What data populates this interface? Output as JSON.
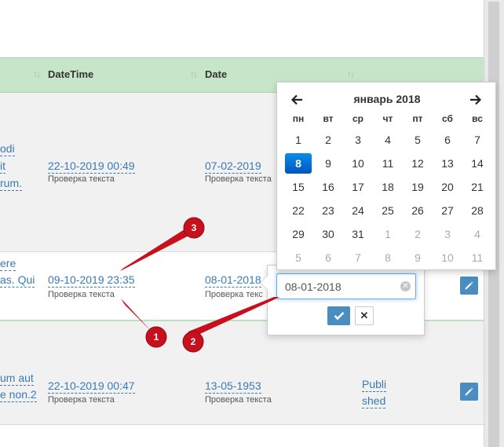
{
  "columns": {
    "datetime": "DateTime",
    "date": "Date"
  },
  "rows": [
    {
      "left_fragments": [
        "odi",
        "it",
        "rum."
      ],
      "datetime": "22-10-2019 00:49",
      "datetime_sub": "Проверка текста",
      "date": "07-02-2019",
      "date_sub": "Проверка текста"
    },
    {
      "left_fragments": [
        "ere",
        "as. Qui"
      ],
      "datetime": "09-10-2019 23:35",
      "datetime_sub": "Проверка текста",
      "date": "08-01-2018",
      "date_sub": "Проверка текс"
    },
    {
      "left_fragments": [
        "um aut",
        "e non.2"
      ],
      "datetime": "22-10-2019 00:47",
      "datetime_sub": "Проверка текста",
      "date": "13-05-1953",
      "date_sub": "Проверка текста",
      "status_lines": [
        "Publi",
        "shed"
      ]
    }
  ],
  "calendar": {
    "title": "январь 2018",
    "weekdays": [
      "пн",
      "вт",
      "ср",
      "чт",
      "пт",
      "сб",
      "вс"
    ],
    "weeks": [
      [
        "1",
        "2",
        "3",
        "4",
        "5",
        "6",
        "7"
      ],
      [
        "8",
        "9",
        "10",
        "11",
        "12",
        "13",
        "14"
      ],
      [
        "15",
        "16",
        "17",
        "18",
        "19",
        "20",
        "21"
      ],
      [
        "22",
        "23",
        "24",
        "25",
        "26",
        "27",
        "28"
      ],
      [
        "29",
        "30",
        "31",
        "1",
        "2",
        "3",
        "4"
      ],
      [
        "5",
        "6",
        "7",
        "8",
        "9",
        "10",
        "11"
      ]
    ],
    "selected_day": "8",
    "prev_icon": "arrow-left-icon",
    "next_icon": "arrow-right-icon"
  },
  "editor": {
    "value": "08-01-2018",
    "ok_icon": "check-icon",
    "cancel_icon": "close-icon",
    "clear_icon": "clear-icon"
  },
  "markers": [
    "1",
    "2",
    "3"
  ],
  "colors": {
    "header_bg": "#c7e6c9",
    "link": "#3a7ab5",
    "button": "#4a8dc0",
    "selected_day": "#0a6fd6",
    "marker": "#c8101c"
  }
}
